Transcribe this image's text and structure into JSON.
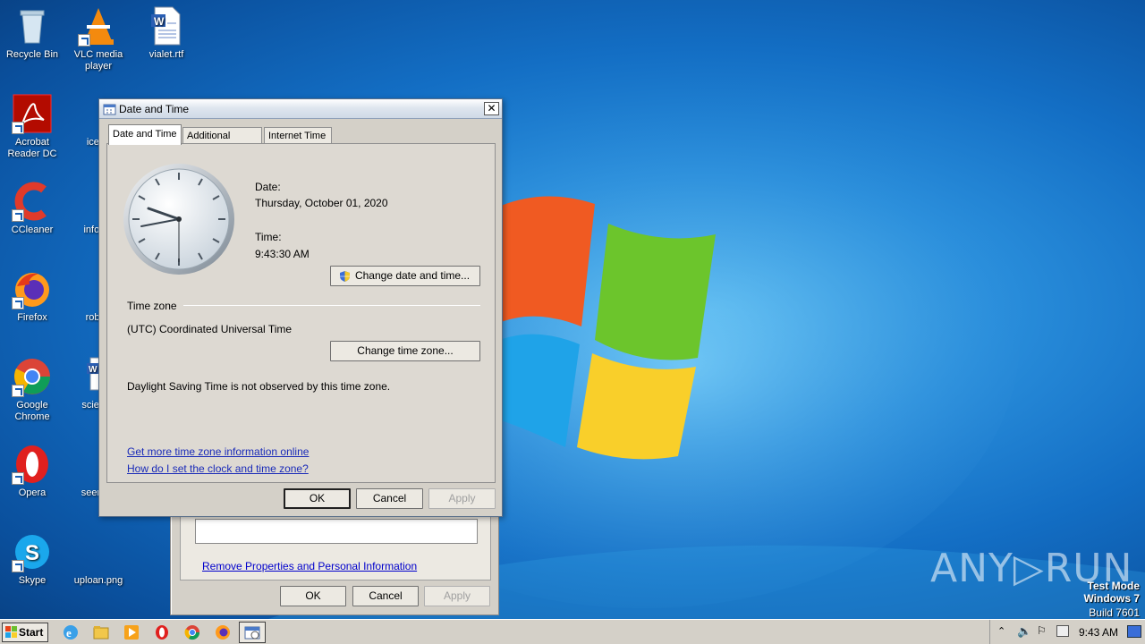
{
  "desktop": {
    "icons": [
      {
        "label": "Recycle Bin",
        "icon": "recycle-bin-icon"
      },
      {
        "label": "VLC media player",
        "icon": "vlc-icon"
      },
      {
        "label": "vialet.rtf",
        "icon": "word-document-icon"
      },
      {
        "label": "Acrobat Reader DC",
        "icon": "acrobat-icon"
      },
      {
        "label": "icehe",
        "icon": "file-icon"
      },
      {
        "label": "CCleaner",
        "icon": "ccleaner-icon"
      },
      {
        "label": "infocor",
        "icon": "file-icon"
      },
      {
        "label": "Firefox",
        "icon": "firefox-icon"
      },
      {
        "label": "robert",
        "icon": "file-icon"
      },
      {
        "label": "Google Chrome",
        "icon": "chrome-icon"
      },
      {
        "label": "science",
        "icon": "word-document-icon"
      },
      {
        "label": "Opera",
        "icon": "opera-icon"
      },
      {
        "label": "seemsp",
        "icon": "file-icon"
      },
      {
        "label": "Skype",
        "icon": "skype-icon"
      },
      {
        "label": "uploan.png",
        "icon": "image-file-icon"
      }
    ]
  },
  "dialog": {
    "title": "Date and Time",
    "close_symbol": "✕",
    "tabs": [
      {
        "label": "Date and Time",
        "active": true
      },
      {
        "label": "Additional Clocks",
        "active": false
      },
      {
        "label": "Internet Time",
        "active": false
      }
    ],
    "date_label": "Date:",
    "date_value": "Thursday, October 01, 2020",
    "time_label": "Time:",
    "time_value": "9:43:30 AM",
    "change_datetime_button": "Change date and time...",
    "timezone_heading": "Time zone",
    "timezone_value": "(UTC) Coordinated Universal Time",
    "change_timezone_button": "Change time zone...",
    "dst_note": "Daylight Saving Time is not observed by this time zone.",
    "link_more_info": "Get more time zone information online",
    "link_how_to": "How do I set the clock and time zone?",
    "ok": "OK",
    "cancel": "Cancel",
    "apply": "Apply"
  },
  "background_window": {
    "link": "Remove Properties and Personal Information",
    "ok": "OK",
    "cancel": "Cancel",
    "apply": "Apply"
  },
  "taskbar": {
    "start_label": "Start",
    "pinned": [
      "internet-explorer-icon",
      "explorer-folder-icon",
      "media-player-icon",
      "opera-icon",
      "chrome-icon",
      "firefox-icon",
      "date-time-window-icon"
    ],
    "clock": "9:43 AM"
  },
  "watermark": {
    "line1": "Test Mode",
    "line2": "Windows 7",
    "line3": "Build 7601",
    "brand": "ANY▷RUN"
  },
  "colors": {
    "desktop_blue": "#136ec4",
    "dialog_face": "#d4d0c8",
    "link_blue": "#1a2bb8"
  }
}
